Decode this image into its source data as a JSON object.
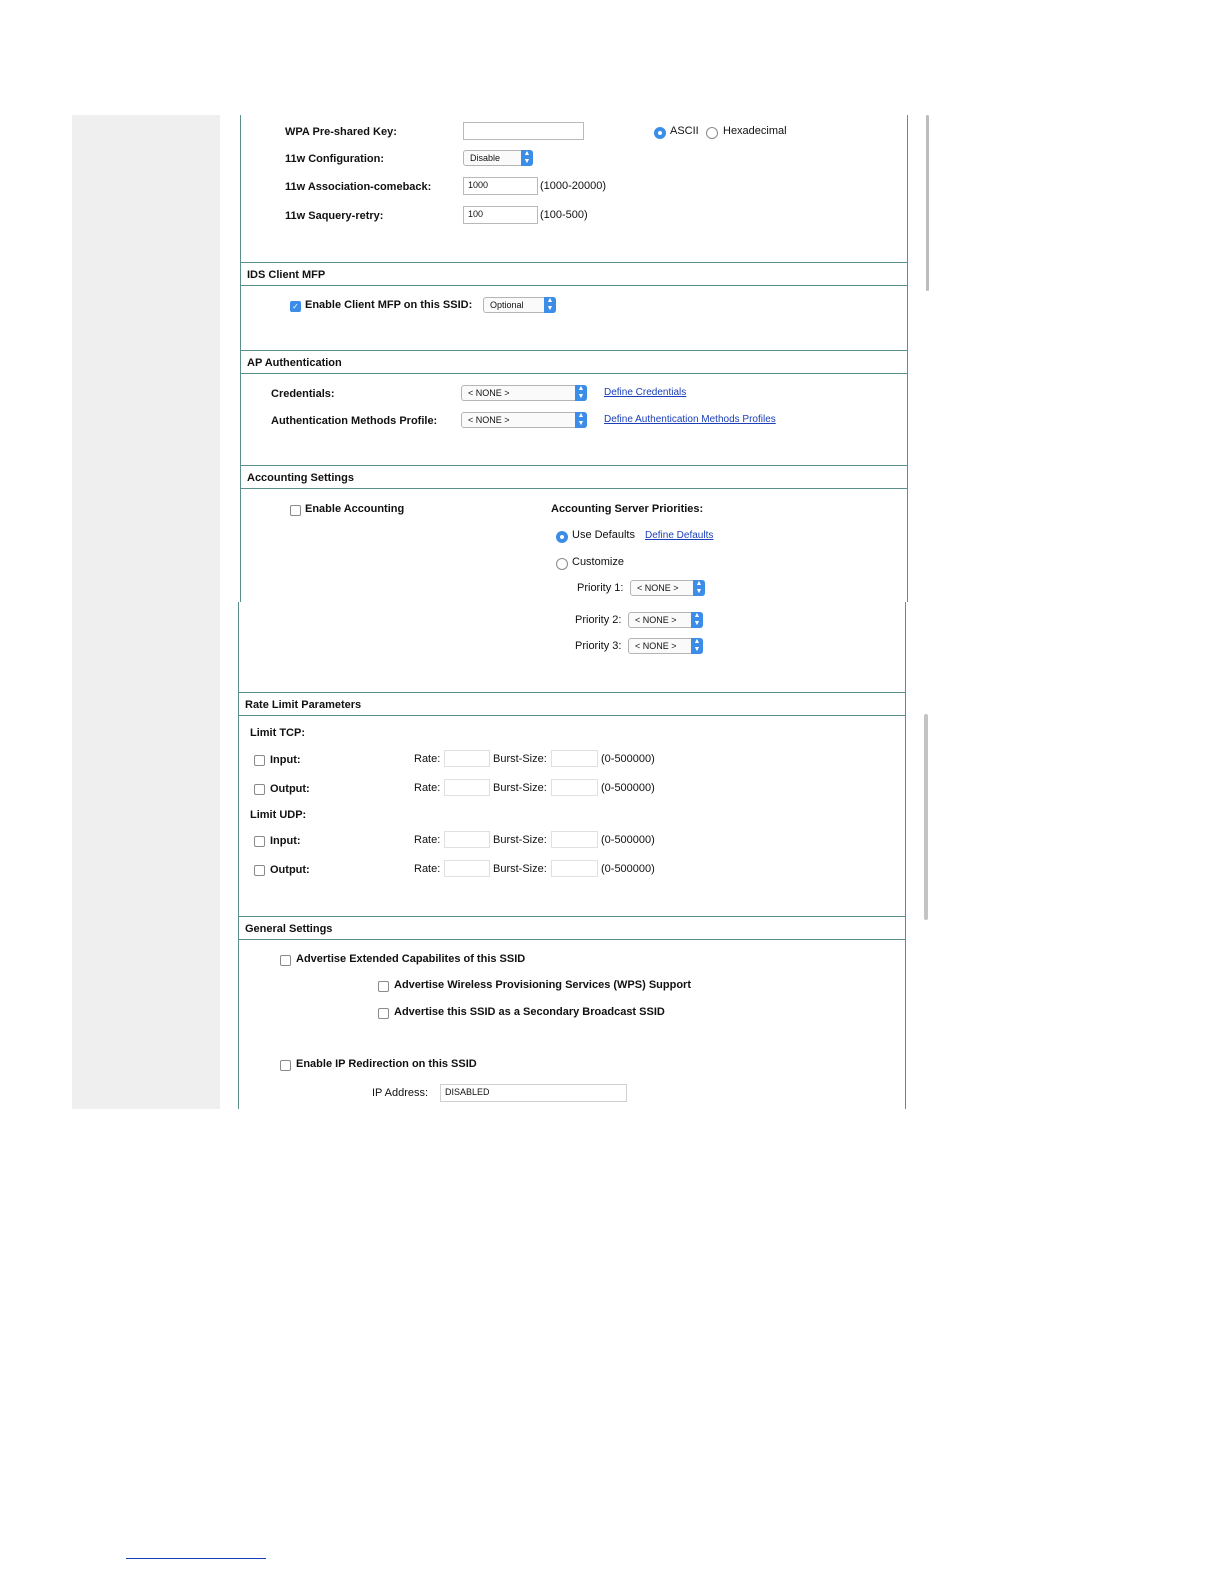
{
  "wpa": {
    "psk_label": "WPA Pre-shared Key:",
    "psk_value": "",
    "ascii_label": "ASCII",
    "hex_label": "Hexadecimal",
    "w11_config_label": "11w Configuration:",
    "w11_config_value": "Disable",
    "assoc_label": "11w Association-comeback:",
    "assoc_value": "1000",
    "assoc_range": "(1000-20000)",
    "saquery_label": "11w Saquery-retry:",
    "saquery_value": "100",
    "saquery_range": "(100-500)"
  },
  "ids": {
    "title": "IDS Client MFP",
    "enable_label": "Enable Client MFP on this SSID:",
    "mfp_value": "Optional"
  },
  "ap_auth": {
    "title": "AP Authentication",
    "credentials_label": "Credentials:",
    "credentials_value": "< NONE >",
    "credentials_link": "Define Credentials",
    "methods_label": "Authentication Methods Profile:",
    "methods_value": "< NONE >",
    "methods_link": "Define Authentication Methods Profiles"
  },
  "accounting": {
    "title": "Accounting Settings",
    "enable_label": "Enable Accounting",
    "priorities_label": "Accounting Server Priorities:",
    "use_defaults_label": "Use Defaults",
    "define_defaults_link": "Define Defaults",
    "customize_label": "Customize",
    "priority1_label": "Priority 1:",
    "priority2_label": "Priority 2:",
    "priority3_label": "Priority 3:",
    "priority_value": "< NONE >"
  },
  "rate_limit": {
    "title": "Rate Limit Parameters",
    "tcp_label": "Limit TCP:",
    "udp_label": "Limit UDP:",
    "input_label": "Input:",
    "output_label": "Output:",
    "rate_label": "Rate:",
    "burst_label": "Burst-Size:",
    "range": "(0-500000)"
  },
  "general": {
    "title": "General Settings",
    "advertise_ext_label": "Advertise Extended Capabilites of this SSID",
    "advertise_wps_label": "Advertise Wireless Provisioning Services (WPS) Support",
    "advertise_secondary_label": "Advertise this SSID as a Secondary Broadcast SSID",
    "ip_redirect_label": "Enable IP Redirection on this SSID",
    "ip_address_label": "IP Address:",
    "ip_address_value": "DISABLED"
  },
  "colors": {
    "accent": "#3b8de8",
    "border": "#5b8f8a",
    "link": "#1a3fb8"
  }
}
